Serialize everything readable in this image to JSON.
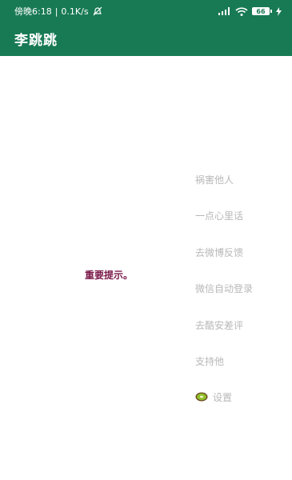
{
  "status_bar": {
    "time": "傍晚6:18",
    "speed": "0.1K/s",
    "battery": "66",
    "icons": [
      "no-notification-icon",
      "signal-icon",
      "wifi-icon",
      "battery-icon",
      "charging-icon"
    ]
  },
  "app": {
    "title": "李跳跳",
    "accent_color": "#187a55"
  },
  "notice": {
    "text": "重要提示。",
    "color": "#7a1a4a"
  },
  "menu": {
    "items": [
      {
        "label": "祸害他人"
      },
      {
        "label": "一点心里话"
      },
      {
        "label": "去微博反馈"
      },
      {
        "label": "微信自动登录"
      },
      {
        "label": "去酷安差评"
      },
      {
        "label": "支持他"
      },
      {
        "label": "设置",
        "icon": "kiwi-icon"
      }
    ]
  }
}
